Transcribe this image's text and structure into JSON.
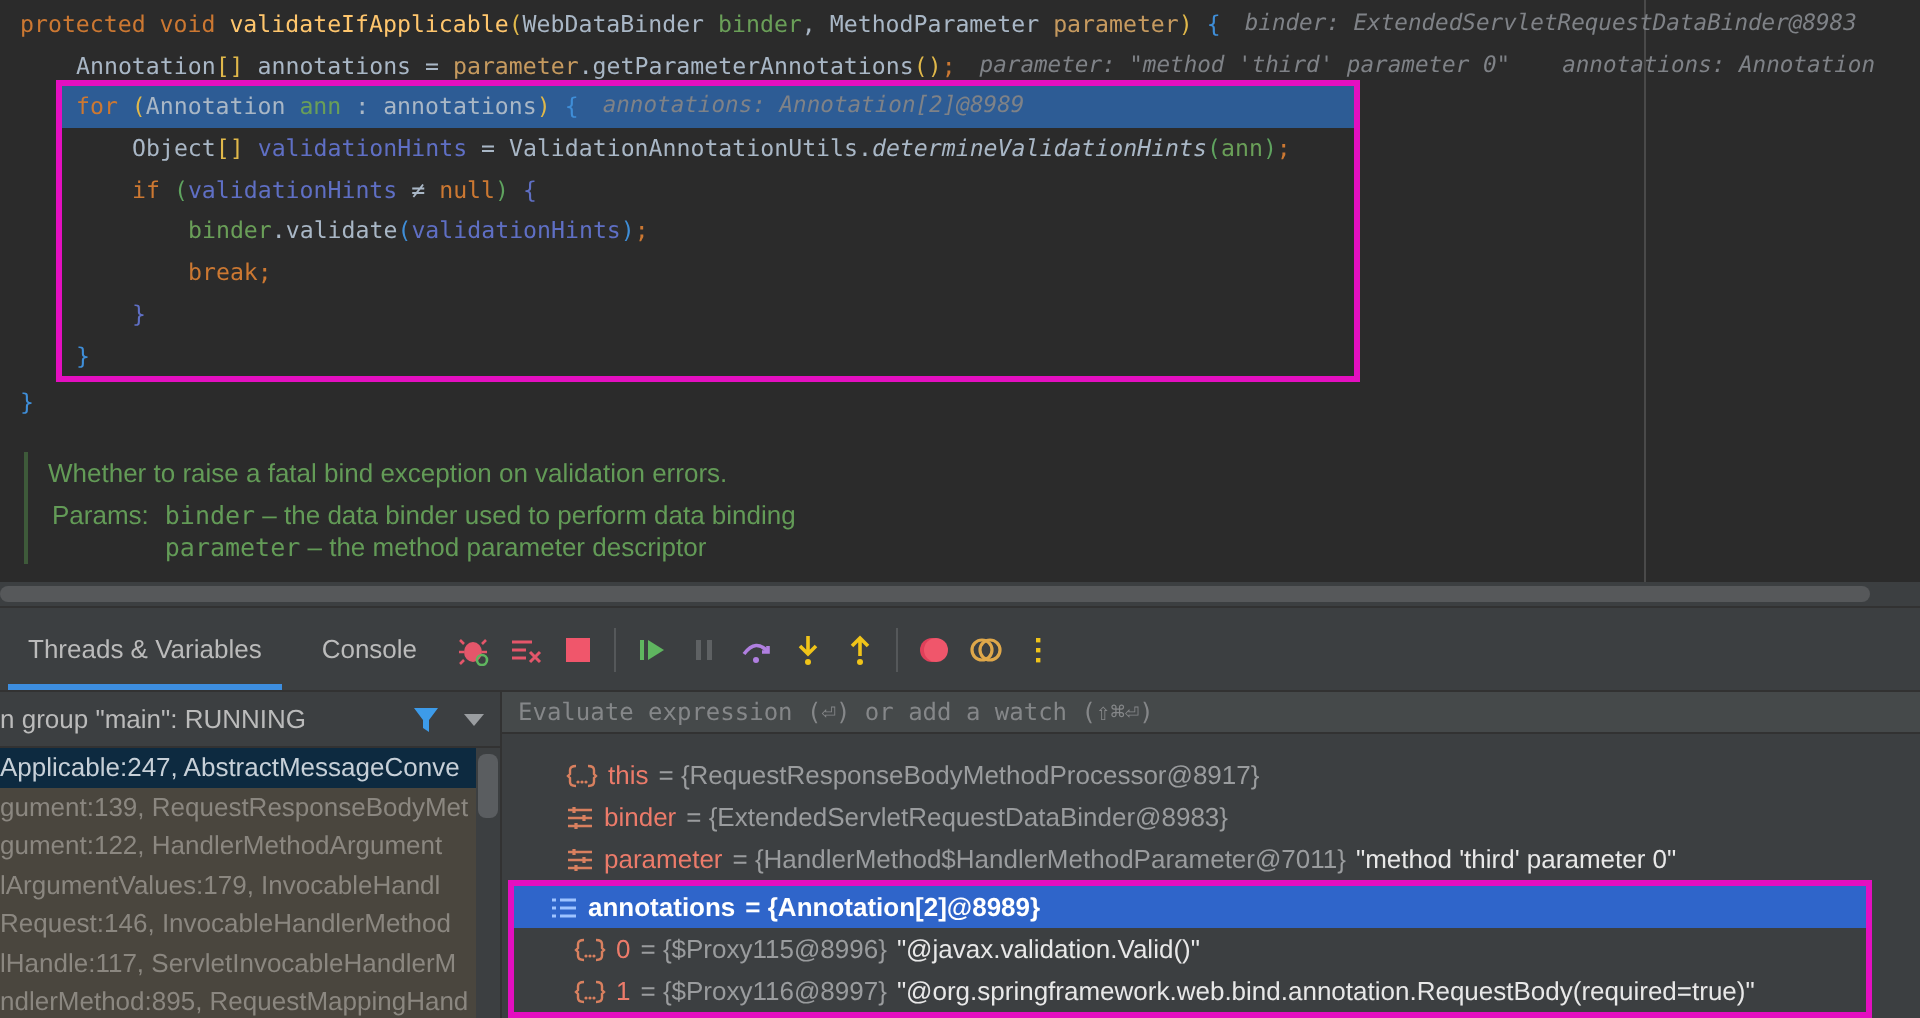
{
  "code": [
    {
      "tokens": [
        {
          "text": "protected void ",
          "kind": "kw"
        },
        {
          "text": "validateIfApplicable",
          "kind": "decl"
        },
        {
          "text": "(",
          "kind": "paren"
        },
        {
          "text": "WebDataBinder ",
          "kind": "plain"
        },
        {
          "text": "binder",
          "kind": "green"
        },
        {
          "text": ", MethodParameter ",
          "kind": "plain"
        },
        {
          "text": "parameter",
          "kind": "tan"
        },
        {
          "text": ") ",
          "kind": "paren"
        },
        {
          "text": "{",
          "kind": "brace"
        }
      ],
      "hints": [
        "binder: ExtendedServletRequestDataBinder@8983"
      ],
      "current": false,
      "boxed": false,
      "close": [
        {
          "text": "}",
          "kind": "brace"
        }
      ],
      "children": [
        {
          "tokens": [
            {
              "text": "Annotation",
              "kind": "plain"
            },
            {
              "text": "[]",
              "kind": "paren"
            },
            {
              "text": " annotations = ",
              "kind": "plain"
            },
            {
              "text": "parameter",
              "kind": "tan"
            },
            {
              "text": ".getParameterAnnotations",
              "kind": "plain"
            },
            {
              "text": "()",
              "kind": "paren"
            },
            {
              "text": ";",
              "kind": "kw"
            }
          ],
          "hints": [
            "parameter: \"method 'third' parameter 0\"",
            "annotations: Annotation"
          ],
          "current": false,
          "boxed": false
        },
        {
          "tokens": [
            {
              "text": "for ",
              "kind": "kw"
            },
            {
              "text": "(",
              "kind": "paren"
            },
            {
              "text": "Annotation ",
              "kind": "plain"
            },
            {
              "text": "ann",
              "kind": "green"
            },
            {
              "text": " : annotations",
              "kind": "plain"
            },
            {
              "text": ") ",
              "kind": "paren"
            },
            {
              "text": "{",
              "kind": "brace"
            }
          ],
          "hints": [
            "annotations: Annotation[2]@8989"
          ],
          "current": true,
          "boxed": true,
          "close": [
            {
              "text": "}",
              "kind": "brace"
            }
          ],
          "children": [
            {
              "tokens": [
                {
                  "text": "Object",
                  "kind": "plain"
                },
                {
                  "text": "[] ",
                  "kind": "paren"
                },
                {
                  "text": "validationHints",
                  "kind": "blue"
                },
                {
                  "text": " = ValidationAnnotationUtils.",
                  "kind": "plain"
                },
                {
                  "text": "determineValidationHints",
                  "kind": "italic"
                },
                {
                  "text": "(",
                  "kind": "greenparen"
                },
                {
                  "text": "ann",
                  "kind": "green"
                },
                {
                  "text": ")",
                  "kind": "greenparen"
                },
                {
                  "text": ";",
                  "kind": "kw"
                }
              ],
              "current": false,
              "boxed": false
            },
            {
              "tokens": [
                {
                  "text": "if ",
                  "kind": "kw"
                },
                {
                  "text": "(",
                  "kind": "greenparen"
                },
                {
                  "text": "validationHints",
                  "kind": "blue"
                },
                {
                  "text": " ≠ ",
                  "kind": "plain"
                },
                {
                  "text": "null",
                  "kind": "kw"
                },
                {
                  "text": ") ",
                  "kind": "greenparen"
                },
                {
                  "text": "{",
                  "kind": "brace2"
                }
              ],
              "current": false,
              "boxed": false,
              "close": [
                {
                  "text": "}",
                  "kind": "brace2"
                }
              ],
              "children": [
                {
                  "tokens": [
                    {
                      "text": "binder",
                      "kind": "green"
                    },
                    {
                      "text": ".validate",
                      "kind": "plain"
                    },
                    {
                      "text": "(",
                      "kind": "bparen"
                    },
                    {
                      "text": "validationHints",
                      "kind": "blue"
                    },
                    {
                      "text": ")",
                      "kind": "bparen"
                    },
                    {
                      "text": ";",
                      "kind": "kw"
                    }
                  ],
                  "current": false,
                  "boxed": false
                },
                {
                  "tokens": [
                    {
                      "text": "break;",
                      "kind": "kw"
                    }
                  ],
                  "current": false,
                  "boxed": false
                }
              ]
            }
          ]
        }
      ]
    }
  ],
  "doc": {
    "summary": "Whether to raise a fatal bind exception on validation errors.",
    "params_label": "Params:",
    "params": [
      {
        "name": "binder",
        "description": "– the data binder used to perform data binding"
      },
      {
        "name": "parameter",
        "description": "– the method parameter descriptor"
      }
    ]
  },
  "tabs": [
    {
      "label": "Threads & Variables",
      "selected": true
    },
    {
      "label": "Console",
      "selected": false
    }
  ],
  "thread": "n group \"main\": RUNNING",
  "frames": [
    {
      "text": "Applicable:247, AbstractMessageConve",
      "selected": true
    },
    {
      "text": "gument:139, RequestResponseBodyMet",
      "selected": false
    },
    {
      "text": "gument:122, HandlerMethodArgument",
      "selected": false
    },
    {
      "text": "lArgumentValues:179, InvocableHandl",
      "selected": false
    },
    {
      "text": "Request:146, InvocableHandlerMethod",
      "selected": false
    },
    {
      "text": "lHandle:117, ServletInvocableHandlerM",
      "selected": false
    },
    {
      "text": "ndlerMethod:895, RequestMappingHand",
      "selected": false
    }
  ],
  "evaluate": {
    "placeholder": "Evaluate expression (⏎) or add a watch (⇧⌘⏎)"
  },
  "variables": [
    {
      "kind": "object",
      "name": "this",
      "value": "= {RequestResponseBodyMethodProcessor@8917}",
      "selected": false,
      "boxed": false
    },
    {
      "kind": "param",
      "name": "binder",
      "value": "= {ExtendedServletRequestDataBinder@8983}",
      "selected": false,
      "boxed": false
    },
    {
      "kind": "param",
      "name": "parameter",
      "value": "= {HandlerMethod$HandlerMethodParameter@7011}",
      "string": "\"method 'third' parameter 0\"",
      "selected": false,
      "boxed": false
    },
    {
      "kind": "array",
      "name": "annotations",
      "value": "= {Annotation[2]@8989}",
      "selected": true,
      "boxed": true,
      "children": [
        {
          "kind": "object",
          "name": "0",
          "value": "= {$Proxy115@8996}",
          "string": "\"@javax.validation.Valid()\"",
          "selected": false
        },
        {
          "kind": "object",
          "name": "1",
          "value": "= {$Proxy116@8997}",
          "string": "\"@org.springframework.web.bind.annotation.RequestBody(required=true)\"",
          "selected": false
        }
      ]
    }
  ]
}
